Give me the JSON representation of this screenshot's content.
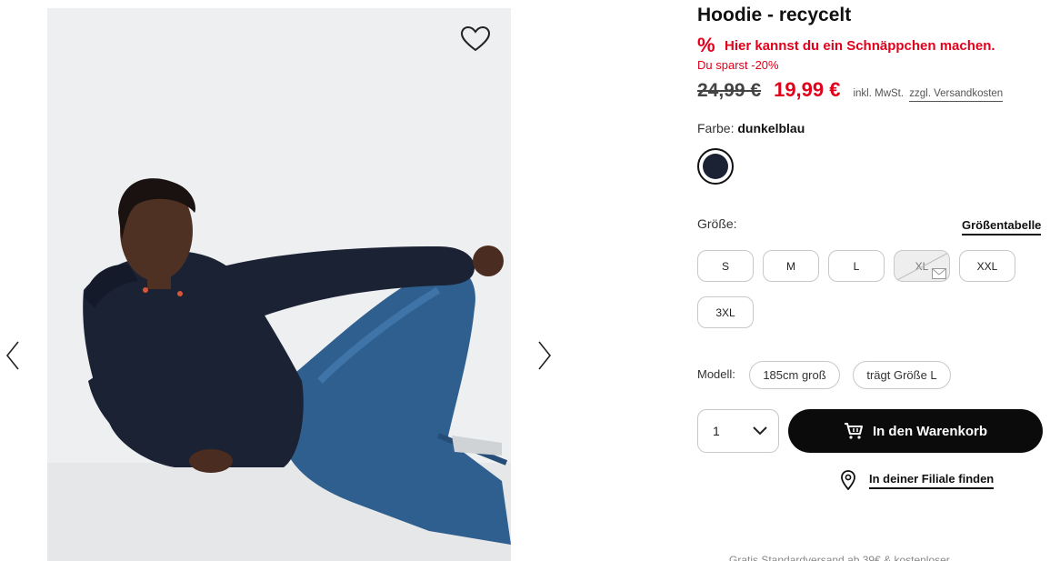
{
  "product": {
    "title": "Hoodie - recycelt",
    "deal_text": "Hier kannst du ein Schnäppchen machen.",
    "deal_icon": "percent-icon",
    "savings": "Du sparst -20%",
    "old_price": "24,99 €",
    "new_price": "19,99 €",
    "vat_text": "inkl. MwSt.",
    "shipping_link": "zzgl. Versandkosten"
  },
  "color": {
    "label": "Farbe:",
    "value": "dunkelblau",
    "swatch_hex": "#1b2234"
  },
  "sizes": {
    "label": "Größe:",
    "table_link": "Größentabelle",
    "options": [
      {
        "label": "S",
        "available": true
      },
      {
        "label": "M",
        "available": true
      },
      {
        "label": "L",
        "available": true
      },
      {
        "label": "XL",
        "available": false
      },
      {
        "label": "XXL",
        "available": true
      },
      {
        "label": "3XL",
        "available": true
      }
    ]
  },
  "model": {
    "label": "Modell:",
    "height": "185cm groß",
    "size": "trägt Größe L"
  },
  "quantity": {
    "value": "1"
  },
  "cart": {
    "button_label": "In den Warenkorb"
  },
  "store": {
    "link": "In deiner Filiale finden"
  },
  "footer": {
    "shipping_note": "Gratis Standardversand ab 39€ & kostenloser"
  },
  "colors": {
    "accent_red": "#e2001a",
    "button_black": "#0b0b0b"
  }
}
